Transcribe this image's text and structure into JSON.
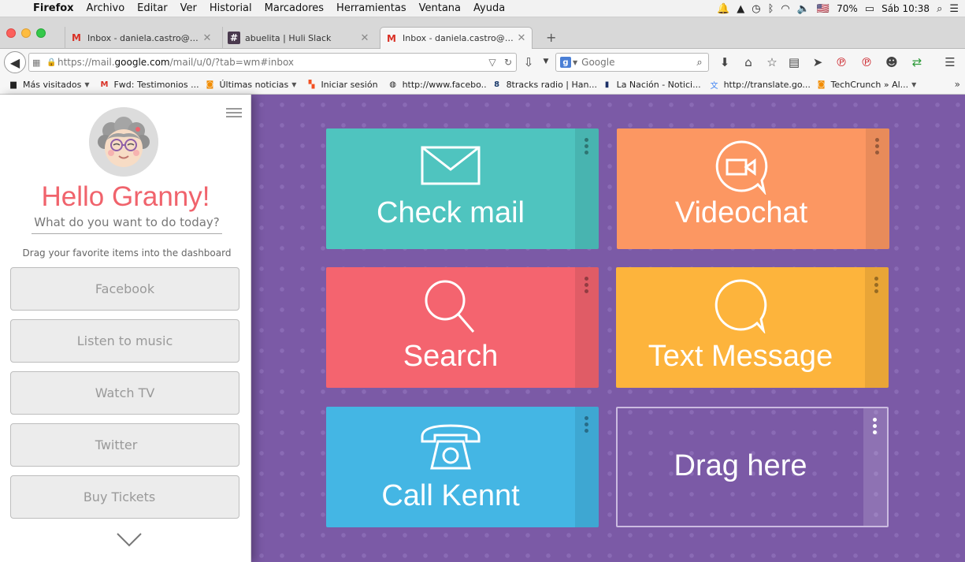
{
  "menubar": {
    "app_name": "Firefox",
    "menus": [
      "Archivo",
      "Editar",
      "Ver",
      "Historial",
      "Marcadores",
      "Herramientas",
      "Ventana",
      "Ayuda"
    ],
    "battery": "70%",
    "clock": "Sáb 10:38"
  },
  "tabs": [
    {
      "label": "Inbox - daniela.castro@huli...",
      "favicon": "gmail-icon"
    },
    {
      "label": "abuelita | Huli Slack",
      "favicon": "slack-icon"
    },
    {
      "label": "Inbox - daniela.castro@huli...",
      "favicon": "gmail-icon",
      "active": true
    }
  ],
  "navbar": {
    "url_prefix": "https://mail.",
    "url_domain": "google.com",
    "url_suffix": "/mail/u/0/?tab=wm#inbox",
    "search_placeholder": "Google"
  },
  "bookmarks": [
    {
      "label": "Más visitados",
      "icon": "folder-icon",
      "dropdown": true
    },
    {
      "label": "Fwd: Testimonios ...",
      "icon": "gmail-icon"
    },
    {
      "label": "Últimas noticias",
      "icon": "rss-icon",
      "dropdown": true
    },
    {
      "label": "Iniciar sesión",
      "icon": "windows-icon"
    },
    {
      "label": "http://www.facebo...",
      "icon": "globe-icon"
    },
    {
      "label": "8tracks radio | Han...",
      "icon": "8tracks-icon"
    },
    {
      "label": "La Nación - Notici...",
      "icon": "nacion-icon"
    },
    {
      "label": "http://translate.go...",
      "icon": "translate-icon"
    },
    {
      "label": "TechCrunch » Al...",
      "icon": "rss-icon",
      "dropdown": true
    }
  ],
  "sidebar": {
    "greeting": "Hello Granny!",
    "question": "What do you want to do today?",
    "hint": "Drag your favorite items into the dashboard",
    "items": [
      "Facebook",
      "Listen to music",
      "Watch TV",
      "Twitter",
      "Buy Tickets"
    ]
  },
  "dashboard": {
    "cards": [
      {
        "label": "Check mail",
        "color": "#4fc4bf",
        "icon": "envelope-icon"
      },
      {
        "label": "Videochat",
        "color": "#fc9762",
        "icon": "video-chat-icon"
      },
      {
        "label": "Search",
        "color": "#f4646f",
        "icon": "search-icon"
      },
      {
        "label": "Text Message",
        "color": "#fdb43c",
        "icon": "speech-bubble-icon"
      },
      {
        "label": "Call Kennt",
        "color": "#44b6e4",
        "icon": "telephone-icon"
      },
      {
        "label": "Drag here",
        "color": "transparent",
        "icon": ""
      }
    ]
  }
}
